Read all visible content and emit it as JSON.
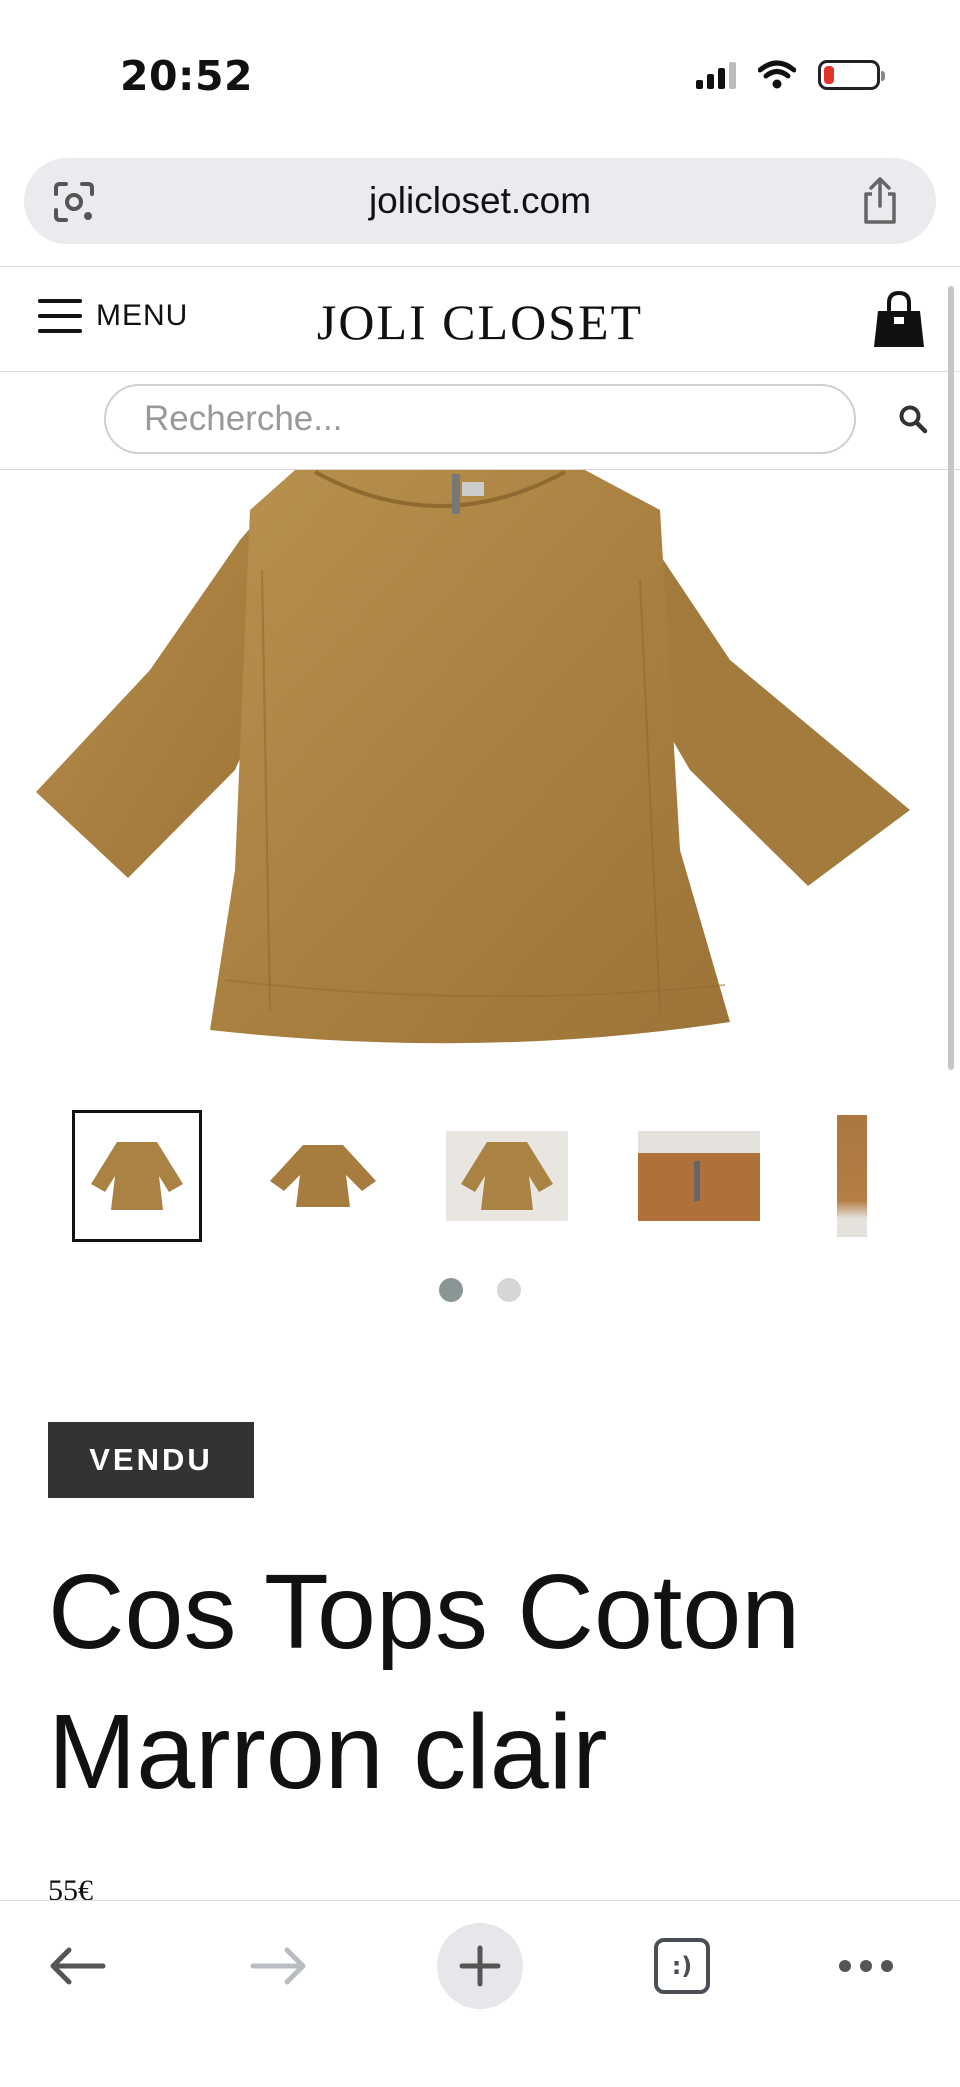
{
  "status_bar": {
    "time": "20:52",
    "icons": [
      "signal-icon",
      "wifi-icon",
      "battery-low-icon"
    ],
    "battery_color": "#e5322b"
  },
  "browser": {
    "url": "jolicloset.com",
    "icons": [
      "lens-icon",
      "share-icon"
    ]
  },
  "header": {
    "menu_label": "MENU",
    "logo_text": "JOLI CLOSET",
    "cart_icon": "handbag-icon"
  },
  "search": {
    "placeholder": "Recherche...",
    "icon": "search-icon"
  },
  "gallery": {
    "main_image": "tan-cotton-top-photo",
    "thumbnails": [
      "thumb-front",
      "thumb-back",
      "thumb-front-2",
      "thumb-zip-detail",
      "thumb-side"
    ],
    "selected_thumbnail": 0,
    "page_count": 2,
    "active_page": 0,
    "dot_active_color": "#8a9595"
  },
  "product": {
    "status_badge": "VENDU",
    "title_line1": "Cos Tops Coton",
    "title_line2": "Marron clair",
    "price": "55€",
    "color": "#b08a4a"
  },
  "toolbar": {
    "items": [
      "back-arrow-icon",
      "forward-arrow-icon",
      "new-tab-plus-icon",
      "tabs-icon",
      "more-dots-icon"
    ],
    "tabs_glyph": ":)"
  }
}
